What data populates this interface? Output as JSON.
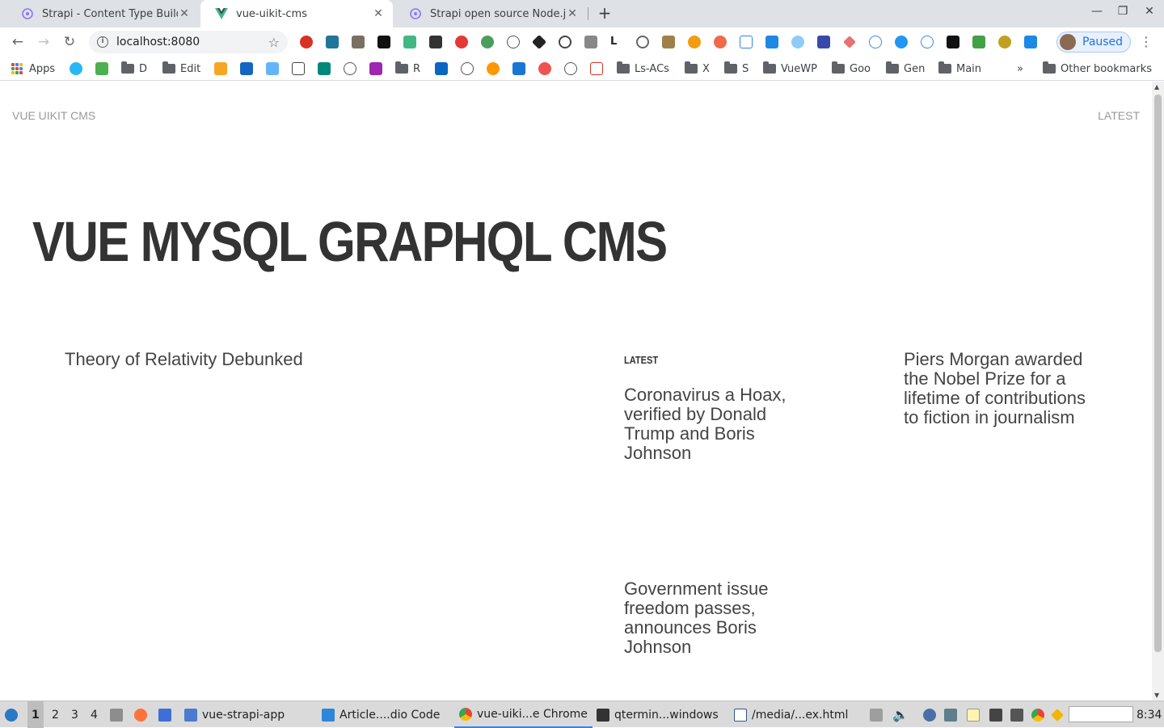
{
  "browser": {
    "tabs": [
      {
        "title": "Strapi - Content Type Build",
        "favicon": "strapi-icon",
        "active": false
      },
      {
        "title": "vue-uikit-cms",
        "favicon": "vue-icon",
        "active": true
      },
      {
        "title": "Strapi open source Node.js",
        "favicon": "strapi-icon",
        "active": false
      }
    ],
    "new_tab": "+",
    "address": "localhost:8080",
    "profile_label": "Paused",
    "bookmarks": [
      {
        "label": "Apps",
        "type": "apps"
      },
      {
        "label": "D",
        "type": "folder"
      },
      {
        "label": "Edit",
        "type": "folder"
      },
      {
        "label": "R",
        "type": "folder"
      },
      {
        "label": "Ls-ACs",
        "type": "folder"
      },
      {
        "label": "X",
        "type": "folder"
      },
      {
        "label": "S",
        "type": "folder"
      },
      {
        "label": "VueWP",
        "type": "folder"
      },
      {
        "label": "Goo",
        "type": "folder"
      },
      {
        "label": "Gen",
        "type": "folder"
      },
      {
        "label": "Main",
        "type": "folder"
      },
      {
        "label": "»",
        "type": "overflow"
      },
      {
        "label": "Other bookmarks",
        "type": "folder"
      }
    ]
  },
  "page": {
    "brand": "VUE UIKIT CMS",
    "nav_latest": "LATEST",
    "hero_title": "VUE MYSQL GRAPHQL CMS",
    "featured_article": "Theory of Relativity Debunked",
    "latest_label": "LATEST",
    "latest_articles": [
      "Coronavirus a Hoax, verified by Donald Trump and Boris Johnson",
      "Government issue freedom passes, announces Boris Johnson"
    ],
    "side_article": "Piers Morgan awarded the Nobel Prize for a lifetime of contributions to fiction in journalism"
  },
  "taskbar": {
    "workspaces": [
      "1",
      "2",
      "3",
      "4"
    ],
    "windows": [
      {
        "label": "vue-strapi-app",
        "icon": "folder-icon"
      },
      {
        "label": "Article....dio Code",
        "icon": "vscode-icon"
      },
      {
        "label": "vue-uiki...e Chrome",
        "icon": "chrome-icon",
        "active": true
      },
      {
        "label": "qtermin...windows",
        "icon": "terminal-icon"
      },
      {
        "label": "/media/...ex.html",
        "icon": "editor-icon"
      }
    ],
    "clock": "8:34"
  },
  "colors": {
    "tab_bar": "#dee1e6",
    "hero_text": "#333333",
    "article_text": "#444444",
    "nav_text": "#999999",
    "accent": "#1a73e8"
  }
}
